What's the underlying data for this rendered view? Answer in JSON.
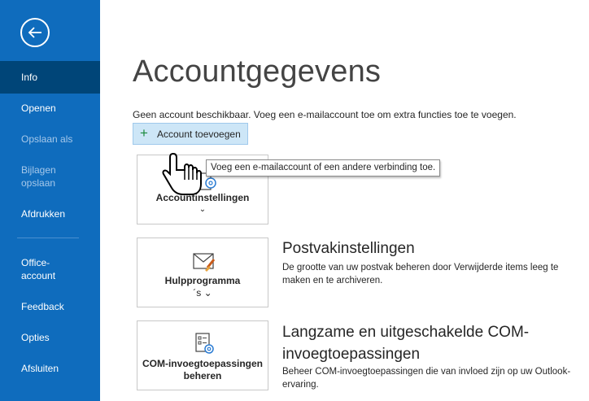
{
  "sidebar": {
    "items": [
      {
        "label": "Info"
      },
      {
        "label": "Openen"
      },
      {
        "label": "Opslaan als"
      },
      {
        "label": "Bijlagen opslaan"
      },
      {
        "label": "Afdrukken"
      },
      {
        "label": "Office-account"
      },
      {
        "label": "Feedback"
      },
      {
        "label": "Opties"
      },
      {
        "label": "Afsluiten"
      }
    ],
    "bijlagen_line1": "Bijlagen",
    "bijlagen_line2": "opslaan",
    "office_line1": "Office-",
    "office_line2": "account"
  },
  "main": {
    "title": "Accountgegevens",
    "no_account_text": "Geen account beschikbaar. Voeg een e-mailaccount toe om extra functies toe te voegen.",
    "add_account_label": "Account toevoegen",
    "tooltip": "Voeg een e-mailaccount of een andere verbinding toe.",
    "tiles": {
      "account_settings": {
        "label": "Accountinstellingen"
      },
      "tools": {
        "line1": "Hulpprogramma",
        "line2": "´s"
      },
      "com": {
        "line1": "COM-invoegtoepassingen",
        "line2": "beheren"
      }
    },
    "sections": {
      "mailbox": {
        "title": "Postvakinstellingen",
        "desc": "De grootte van uw postvak beheren door Verwijderde items leeg te maken en te archiveren."
      },
      "com": {
        "title": "Langzame en uitgeschakelde COM-invoegtoepassingen",
        "desc": "Beheer COM-invoegtoepassingen die van invloed zijn op uw Outlook-ervaring."
      }
    }
  },
  "colors": {
    "sidebar": "#0f6cbd",
    "selected": "#004578",
    "button_bg": "#cde6f7"
  }
}
